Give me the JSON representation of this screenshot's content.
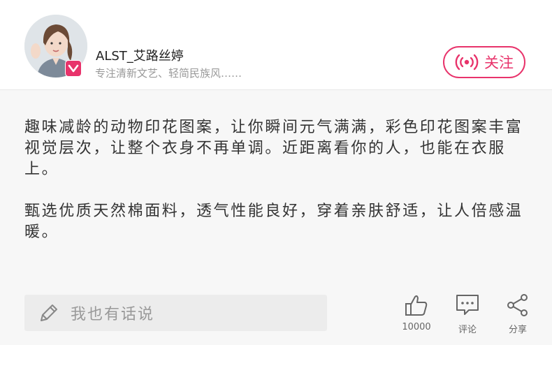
{
  "user": {
    "name": "ALST_艾路丝婷",
    "bio": "专注清新文艺、轻简民族风……",
    "follow_label": "关注"
  },
  "post": {
    "paragraphs": [
      "趣味减龄的动物印花图案，让你瞬间元气满满，彩色印花图案丰富视觉层次，让整个衣身不再单调。近距离看你的人，也能在衣服上。",
      "甄选优质天然棉面料，透气性能良好，穿着亲肤舒适，让人倍感温暖。"
    ]
  },
  "comment": {
    "placeholder": "我也有话说"
  },
  "actions": {
    "like_count": "10000",
    "comment_label": "评论",
    "share_label": "分享"
  },
  "colors": {
    "accent": "#e8336b",
    "content_bg": "#f7f7f7"
  },
  "icons": [
    "verified-v-icon",
    "live-broadcast-icon",
    "pencil-icon",
    "thumbs-up-icon",
    "comment-bubble-icon",
    "share-icon"
  ]
}
